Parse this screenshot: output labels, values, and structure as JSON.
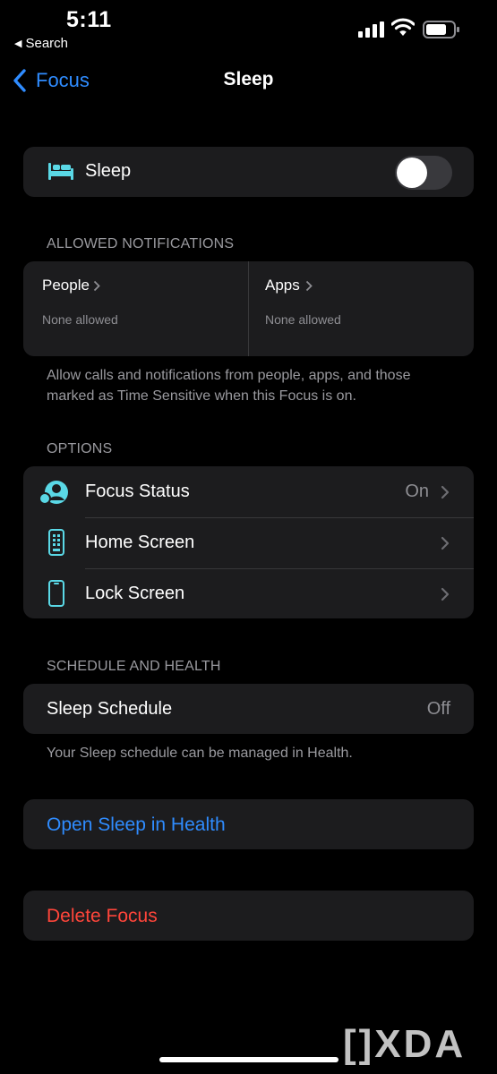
{
  "status_bar": {
    "time": "5:11",
    "back_app": "Search",
    "back_glyph": "◀"
  },
  "nav": {
    "back_label": "Focus",
    "title": "Sleep"
  },
  "sleep_toggle": {
    "label": "Sleep",
    "on": false
  },
  "allowed_notifications": {
    "header": "ALLOWED NOTIFICATIONS",
    "people": {
      "title": "People",
      "subtitle": "None allowed"
    },
    "apps": {
      "title": "Apps",
      "subtitle": "None allowed"
    },
    "footnote": "Allow calls and notifications from people, apps, and those marked as Time Sensitive when this Focus is on."
  },
  "options": {
    "header": "OPTIONS",
    "items": [
      {
        "label": "Focus Status",
        "value": "On",
        "icon": "focus-status-icon"
      },
      {
        "label": "Home Screen",
        "value": "",
        "icon": "home-screen-icon"
      },
      {
        "label": "Lock Screen",
        "value": "",
        "icon": "lock-screen-icon"
      }
    ]
  },
  "schedule": {
    "header": "SCHEDULE AND HEALTH",
    "label": "Sleep Schedule",
    "value": "Off",
    "footnote": "Your Sleep schedule can be managed in Health."
  },
  "actions": {
    "open_health": "Open Sleep in Health",
    "delete_focus": "Delete Focus"
  },
  "watermark": "[]XDA",
  "colors": {
    "accent_blue": "#2f8cff",
    "destructive_red": "#ff453a",
    "icon_teal": "#5ad8e6",
    "card_bg": "#1c1c1e"
  }
}
